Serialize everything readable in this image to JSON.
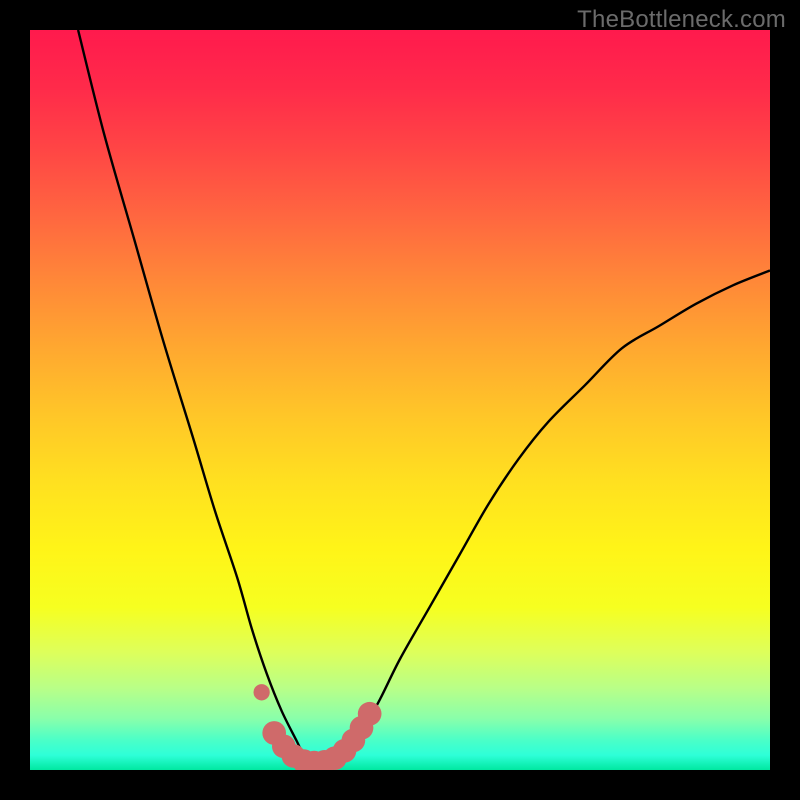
{
  "source_label": "TheBottleneck.com",
  "colors": {
    "background": "#000000",
    "curve": "#000000",
    "markers": "#cf6a6a",
    "text": "#6b6b6b"
  },
  "chart_data": {
    "type": "line",
    "title": "",
    "xlabel": "",
    "ylabel": "",
    "xlim": [
      0,
      100
    ],
    "ylim": [
      0,
      100
    ],
    "grid": false,
    "series": [
      {
        "name": "bottleneck-curve",
        "x": [
          6.5,
          10,
          14,
          18,
          22,
          25,
          28,
          30,
          32,
          34,
          36,
          37,
          38,
          39.5,
          42,
          44,
          47,
          50,
          54,
          58,
          62,
          66,
          70,
          75,
          80,
          85,
          90,
          95,
          100
        ],
        "y": [
          100,
          86,
          72,
          58,
          45,
          35,
          26,
          19,
          13,
          8,
          4,
          2,
          1,
          1,
          2,
          4,
          9,
          15,
          22,
          29,
          36,
          42,
          47,
          52,
          57,
          60,
          63,
          65.5,
          67.5
        ]
      }
    ],
    "markers": [
      {
        "x": 31.3,
        "y": 10.5,
        "r": 1.1
      },
      {
        "x": 33.0,
        "y": 5.0,
        "r": 1.6
      },
      {
        "x": 34.3,
        "y": 3.2,
        "r": 1.6
      },
      {
        "x": 35.6,
        "y": 1.9,
        "r": 1.6
      },
      {
        "x": 37.0,
        "y": 1.2,
        "r": 1.6
      },
      {
        "x": 38.4,
        "y": 1.0,
        "r": 1.6
      },
      {
        "x": 39.8,
        "y": 1.1,
        "r": 1.6
      },
      {
        "x": 41.2,
        "y": 1.6,
        "r": 1.6
      },
      {
        "x": 42.5,
        "y": 2.6,
        "r": 1.6
      },
      {
        "x": 43.7,
        "y": 4.0,
        "r": 1.6
      },
      {
        "x": 44.8,
        "y": 5.7,
        "r": 1.6
      },
      {
        "x": 45.9,
        "y": 7.6,
        "r": 1.6
      }
    ]
  }
}
